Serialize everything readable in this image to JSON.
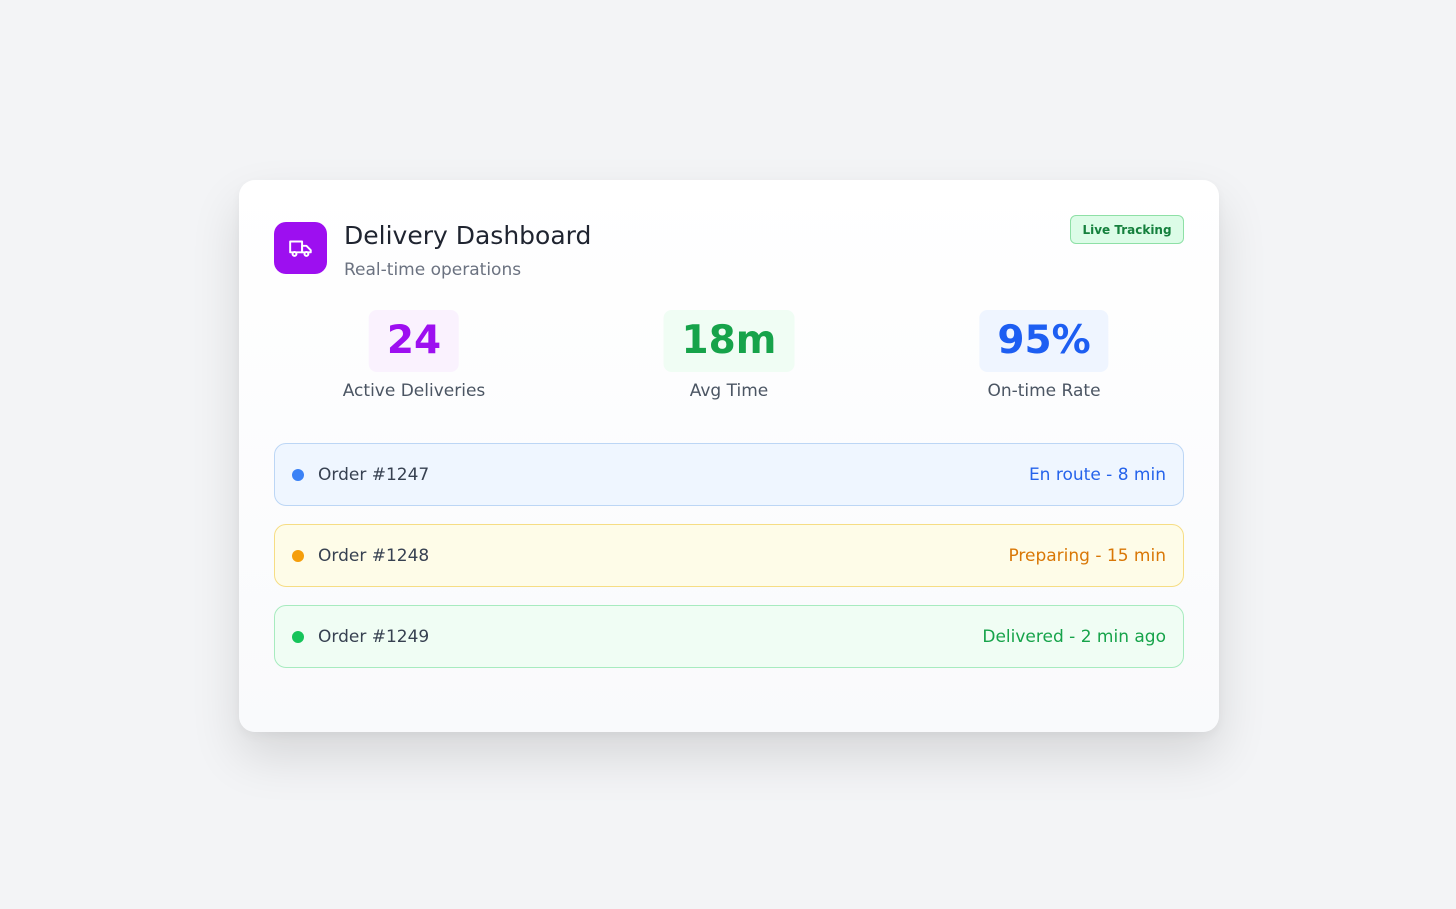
{
  "header": {
    "title": "Delivery Dashboard",
    "subtitle": "Real-time operations",
    "badge": "Live Tracking",
    "logo_icon": "truck-icon"
  },
  "stats": [
    {
      "value": "24",
      "label": "Active Deliveries",
      "color": "#9d0ff0",
      "bg": "#faf2fe"
    },
    {
      "value": "18m",
      "label": "Avg Time",
      "color": "#16a34a",
      "bg": "#f0fdf4"
    },
    {
      "value": "95%",
      "label": "On-time Rate",
      "color": "#1d5ef2",
      "bg": "#eff5ff"
    }
  ],
  "orders": [
    {
      "id": "Order #1247",
      "status": "En route - 8 min",
      "dot": "#3b82f6",
      "status_color": "#2563eb",
      "bg": "#eff6ff",
      "border": "#bcd6f5"
    },
    {
      "id": "Order #1248",
      "status": "Preparing - 15 min",
      "dot": "#f59e0b",
      "status_color": "#d97706",
      "bg": "#fefce8",
      "border": "#f6dd84"
    },
    {
      "id": "Order #1249",
      "status": "Delivered - 2 min ago",
      "dot": "#16c45a",
      "status_color": "#16a34a",
      "bg": "#f0fdf4",
      "border": "#a7ebbf"
    }
  ]
}
